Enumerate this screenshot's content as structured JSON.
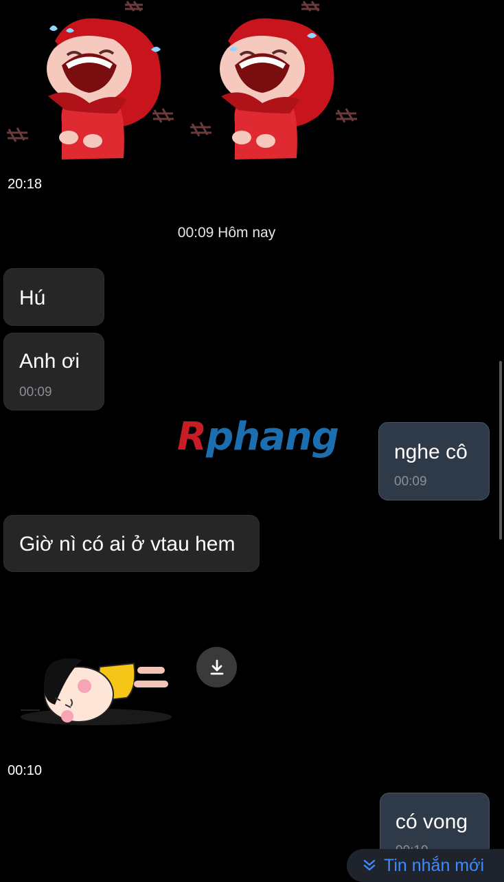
{
  "messages": {
    "sticker_time_1": "20:18",
    "day_separator": "00:09 Hôm nay",
    "msg1_text": "Hú",
    "msg2_text": "Anh ơi",
    "msg2_time": "00:09",
    "msg3_text": "nghe cô",
    "msg3_time": "00:09",
    "msg4_text": "Giờ nì có ai ở vtau hem",
    "sticker_time_2": "00:10",
    "msg5_text": "có vong",
    "msg5_time": "00:10"
  },
  "watermark": {
    "first": "R",
    "rest": "phang"
  },
  "new_messages_label": "Tin nhắn mới",
  "icons": {
    "download": "download-icon",
    "chevrons": "double-chevron-down-icon"
  },
  "colors": {
    "background": "#000000",
    "incoming_bubble": "#262626",
    "outgoing_bubble": "#2f3a48",
    "accent": "#3d8bff"
  }
}
